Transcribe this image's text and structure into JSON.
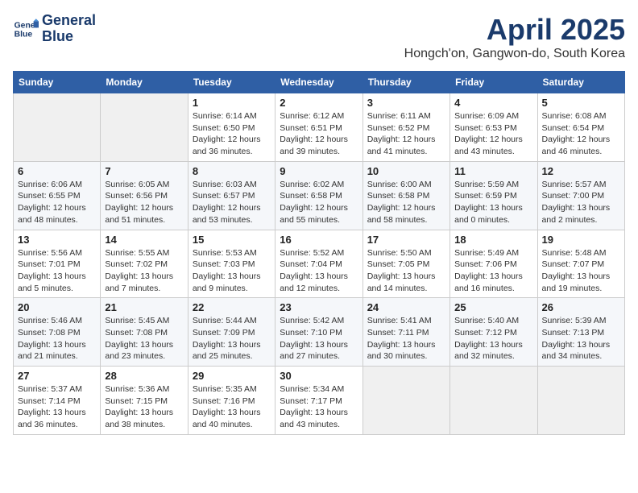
{
  "header": {
    "logo_line1": "General",
    "logo_line2": "Blue",
    "title": "April 2025",
    "subtitle": "Hongch'on, Gangwon-do, South Korea"
  },
  "days_of_week": [
    "Sunday",
    "Monday",
    "Tuesday",
    "Wednesday",
    "Thursday",
    "Friday",
    "Saturday"
  ],
  "weeks": [
    [
      {
        "day": "",
        "info": ""
      },
      {
        "day": "",
        "info": ""
      },
      {
        "day": "1",
        "info": "Sunrise: 6:14 AM\nSunset: 6:50 PM\nDaylight: 12 hours\nand 36 minutes."
      },
      {
        "day": "2",
        "info": "Sunrise: 6:12 AM\nSunset: 6:51 PM\nDaylight: 12 hours\nand 39 minutes."
      },
      {
        "day": "3",
        "info": "Sunrise: 6:11 AM\nSunset: 6:52 PM\nDaylight: 12 hours\nand 41 minutes."
      },
      {
        "day": "4",
        "info": "Sunrise: 6:09 AM\nSunset: 6:53 PM\nDaylight: 12 hours\nand 43 minutes."
      },
      {
        "day": "5",
        "info": "Sunrise: 6:08 AM\nSunset: 6:54 PM\nDaylight: 12 hours\nand 46 minutes."
      }
    ],
    [
      {
        "day": "6",
        "info": "Sunrise: 6:06 AM\nSunset: 6:55 PM\nDaylight: 12 hours\nand 48 minutes."
      },
      {
        "day": "7",
        "info": "Sunrise: 6:05 AM\nSunset: 6:56 PM\nDaylight: 12 hours\nand 51 minutes."
      },
      {
        "day": "8",
        "info": "Sunrise: 6:03 AM\nSunset: 6:57 PM\nDaylight: 12 hours\nand 53 minutes."
      },
      {
        "day": "9",
        "info": "Sunrise: 6:02 AM\nSunset: 6:58 PM\nDaylight: 12 hours\nand 55 minutes."
      },
      {
        "day": "10",
        "info": "Sunrise: 6:00 AM\nSunset: 6:58 PM\nDaylight: 12 hours\nand 58 minutes."
      },
      {
        "day": "11",
        "info": "Sunrise: 5:59 AM\nSunset: 6:59 PM\nDaylight: 13 hours\nand 0 minutes."
      },
      {
        "day": "12",
        "info": "Sunrise: 5:57 AM\nSunset: 7:00 PM\nDaylight: 13 hours\nand 2 minutes."
      }
    ],
    [
      {
        "day": "13",
        "info": "Sunrise: 5:56 AM\nSunset: 7:01 PM\nDaylight: 13 hours\nand 5 minutes."
      },
      {
        "day": "14",
        "info": "Sunrise: 5:55 AM\nSunset: 7:02 PM\nDaylight: 13 hours\nand 7 minutes."
      },
      {
        "day": "15",
        "info": "Sunrise: 5:53 AM\nSunset: 7:03 PM\nDaylight: 13 hours\nand 9 minutes."
      },
      {
        "day": "16",
        "info": "Sunrise: 5:52 AM\nSunset: 7:04 PM\nDaylight: 13 hours\nand 12 minutes."
      },
      {
        "day": "17",
        "info": "Sunrise: 5:50 AM\nSunset: 7:05 PM\nDaylight: 13 hours\nand 14 minutes."
      },
      {
        "day": "18",
        "info": "Sunrise: 5:49 AM\nSunset: 7:06 PM\nDaylight: 13 hours\nand 16 minutes."
      },
      {
        "day": "19",
        "info": "Sunrise: 5:48 AM\nSunset: 7:07 PM\nDaylight: 13 hours\nand 19 minutes."
      }
    ],
    [
      {
        "day": "20",
        "info": "Sunrise: 5:46 AM\nSunset: 7:08 PM\nDaylight: 13 hours\nand 21 minutes."
      },
      {
        "day": "21",
        "info": "Sunrise: 5:45 AM\nSunset: 7:08 PM\nDaylight: 13 hours\nand 23 minutes."
      },
      {
        "day": "22",
        "info": "Sunrise: 5:44 AM\nSunset: 7:09 PM\nDaylight: 13 hours\nand 25 minutes."
      },
      {
        "day": "23",
        "info": "Sunrise: 5:42 AM\nSunset: 7:10 PM\nDaylight: 13 hours\nand 27 minutes."
      },
      {
        "day": "24",
        "info": "Sunrise: 5:41 AM\nSunset: 7:11 PM\nDaylight: 13 hours\nand 30 minutes."
      },
      {
        "day": "25",
        "info": "Sunrise: 5:40 AM\nSunset: 7:12 PM\nDaylight: 13 hours\nand 32 minutes."
      },
      {
        "day": "26",
        "info": "Sunrise: 5:39 AM\nSunset: 7:13 PM\nDaylight: 13 hours\nand 34 minutes."
      }
    ],
    [
      {
        "day": "27",
        "info": "Sunrise: 5:37 AM\nSunset: 7:14 PM\nDaylight: 13 hours\nand 36 minutes."
      },
      {
        "day": "28",
        "info": "Sunrise: 5:36 AM\nSunset: 7:15 PM\nDaylight: 13 hours\nand 38 minutes."
      },
      {
        "day": "29",
        "info": "Sunrise: 5:35 AM\nSunset: 7:16 PM\nDaylight: 13 hours\nand 40 minutes."
      },
      {
        "day": "30",
        "info": "Sunrise: 5:34 AM\nSunset: 7:17 PM\nDaylight: 13 hours\nand 43 minutes."
      },
      {
        "day": "",
        "info": ""
      },
      {
        "day": "",
        "info": ""
      },
      {
        "day": "",
        "info": ""
      }
    ]
  ]
}
